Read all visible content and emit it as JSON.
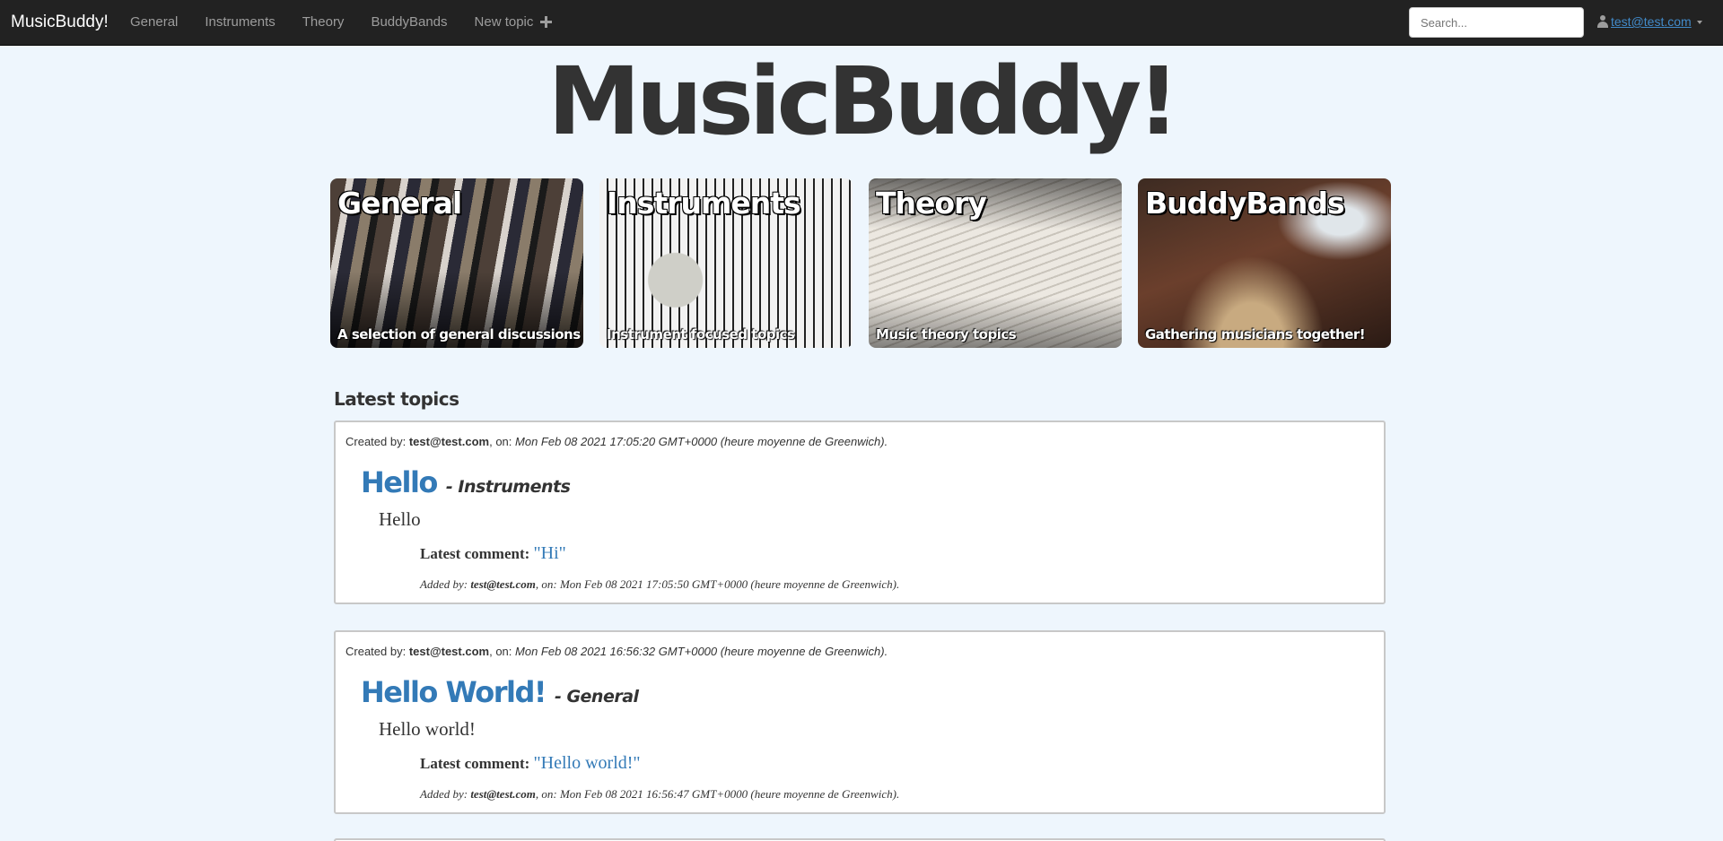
{
  "navbar": {
    "brand": "MusicBuddy!",
    "links": [
      "General",
      "Instruments",
      "Theory",
      "BuddyBands",
      "New topic"
    ],
    "search_placeholder": "Search...",
    "user": "test@test.com"
  },
  "hero_title": "MusicBuddy!",
  "categories": [
    {
      "title": "General",
      "description": "A selection of general discussions"
    },
    {
      "title": "Instruments",
      "description": "Instrument focused topics"
    },
    {
      "title": "Theory",
      "description": "Music theory topics"
    },
    {
      "title": "BuddyBands",
      "description": "Gathering musicians together!"
    }
  ],
  "latest_heading": "Latest topics",
  "topics": [
    {
      "created_label": "Created by:",
      "author": "test@test.com",
      "on_label": ", on:",
      "date": "Mon Feb 08 2021 17:05:20 GMT+0000 (heure moyenne de Greenwich).",
      "title": "Hello",
      "category": "- Instruments",
      "body": "Hello",
      "latest_comment_label": "Latest comment:",
      "latest_comment": "\"Hi\"",
      "added_label": "Added by:",
      "comment_author": "test@test.com",
      "comment_on_label": ", on:",
      "comment_date": "Mon Feb 08 2021 17:05:50 GMT+0000 (heure moyenne de Greenwich)."
    },
    {
      "created_label": "Created by:",
      "author": "test@test.com",
      "on_label": ", on:",
      "date": "Mon Feb 08 2021 16:56:32 GMT+0000 (heure moyenne de Greenwich).",
      "title": "Hello World!",
      "category": "- General",
      "body": "Hello world!",
      "latest_comment_label": "Latest comment:",
      "latest_comment": "\"Hello world!\"",
      "added_label": "Added by:",
      "comment_author": "test@test.com",
      "comment_on_label": ", on:",
      "comment_date": "Mon Feb 08 2021 16:56:47 GMT+0000 (heure moyenne de Greenwich)."
    }
  ]
}
